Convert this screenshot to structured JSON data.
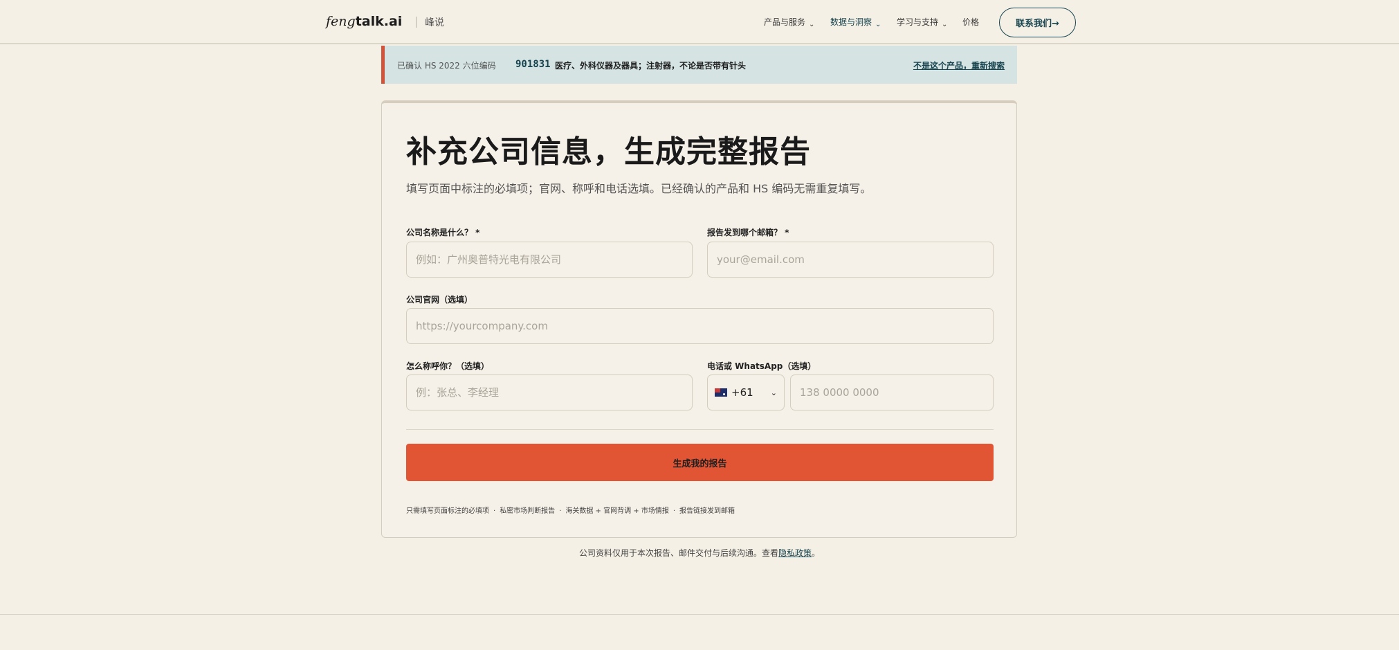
{
  "nav": {
    "logo_italic": "feng",
    "logo_bold": "talk.ai",
    "brand_sub": "峰说",
    "items": [
      {
        "label": "产品与服务",
        "has_dropdown": true
      },
      {
        "label": "数据与洞察",
        "has_dropdown": true
      },
      {
        "label": "学习与支持",
        "has_dropdown": true
      },
      {
        "label": "价格",
        "has_dropdown": false
      }
    ],
    "contact_label": "联系我们→"
  },
  "banner": {
    "label": "已确认 HS 2022 六位编码",
    "code": "901831",
    "description": "医疗、外科仪器及器具；注射器，不论是否带有针头",
    "link": "不是这个产品，重新搜索"
  },
  "form": {
    "title": "补充公司信息，生成完整报告",
    "subtitle": "填写页面中标注的必填项；官网、称呼和电话选填。已经确认的产品和 HS 编码无需重复填写。",
    "company_label": "公司名称是什么？ *",
    "company_placeholder": "例如：广州奥普特光电有限公司",
    "email_label": "报告发到哪个邮箱？ *",
    "email_placeholder": "your@email.com",
    "website_label": "公司官网（选填）",
    "website_placeholder": "https://yourcompany.com",
    "name_label": "怎么称呼你？（选填）",
    "name_placeholder": "例：张总、李经理",
    "phone_label": "电话或 WhatsApp（选填）",
    "country_code": "+61",
    "phone_placeholder": "138 0000 0000",
    "submit_label": "生成我的报告",
    "perks": [
      "只需填写页面标注的必填项",
      "私密市场判断报告",
      "海关数据 + 官网背调 + 市场情报",
      "报告链接发到邮箱"
    ],
    "perk_separator": "·"
  },
  "privacy": {
    "text": "公司资料仅用于本次报告、邮件交付与后续沟通。查看",
    "link": "隐私政策",
    "suffix": "。"
  },
  "colors": {
    "background": "#f5f0e6",
    "accent": "#e15535",
    "teal": "#17444f",
    "banner_bg": "#d5e3e3"
  }
}
